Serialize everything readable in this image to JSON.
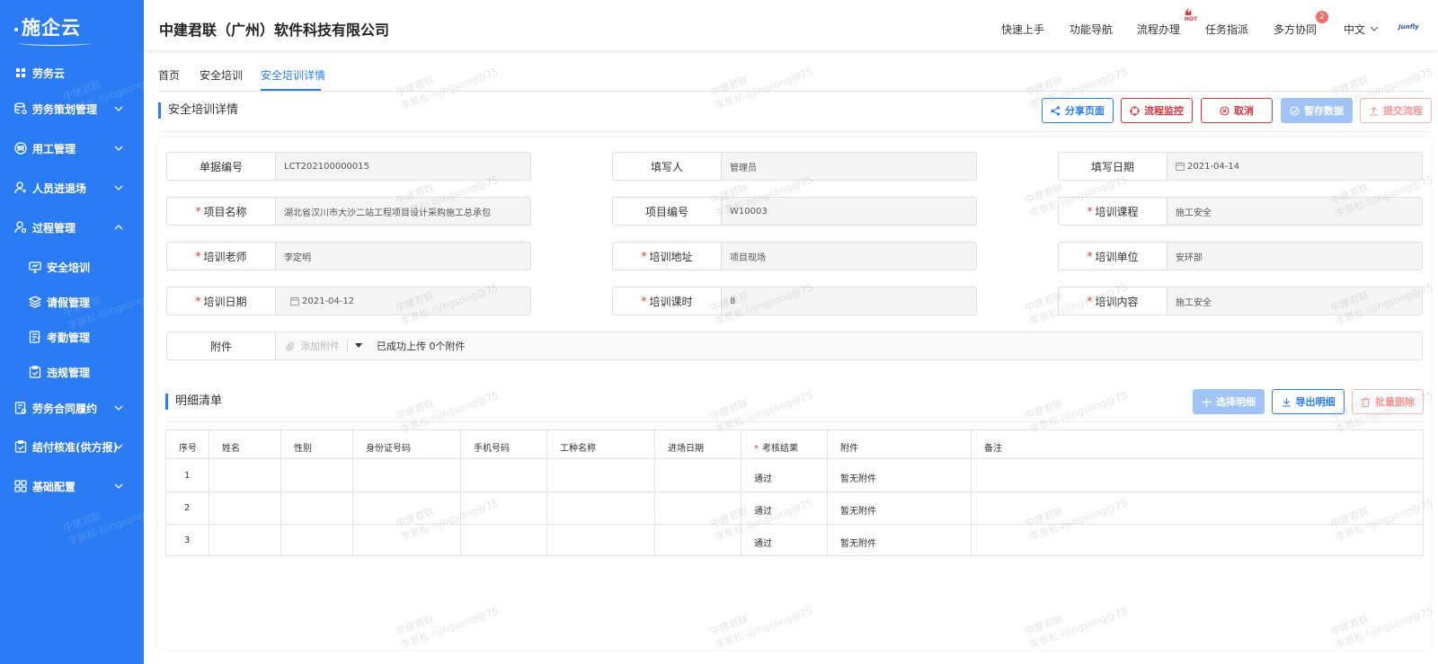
{
  "sidebar": {
    "logo": "施企云",
    "items": [
      {
        "label": "劳务云"
      },
      {
        "label": "劳务策划管理"
      },
      {
        "label": "用工管理"
      },
      {
        "label": "人员进退场"
      },
      {
        "label": "过程管理"
      },
      {
        "label": "安全培训"
      },
      {
        "label": "请假管理"
      },
      {
        "label": "考勤管理"
      },
      {
        "label": "违规管理"
      },
      {
        "label": "劳务合同履约"
      },
      {
        "label": "结付核准(供方报)"
      },
      {
        "label": "基础配置"
      }
    ]
  },
  "header": {
    "company": "中建君联（广州）软件科技有限公司",
    "nav": [
      "快速上手",
      "功能导航",
      "流程办理",
      "任务指派",
      "多方协同",
      "中文"
    ],
    "hot_tag": "HOT",
    "badge": "2",
    "brand_mini": "Junfly"
  },
  "tabs": [
    "首页",
    "安全培训",
    "安全培训详情"
  ],
  "section": {
    "title": "安全培训详情",
    "buttons": {
      "share": "分享页面",
      "monitor": "流程监控",
      "cancel": "取消",
      "save": "暂存数据",
      "submit": "提交流程"
    }
  },
  "form": {
    "doc_no": {
      "label": "单据编号",
      "value": "LCT202100000015"
    },
    "writer": {
      "label": "填写人",
      "value": "管理员"
    },
    "write_date": {
      "label": "填写日期",
      "value": "2021-04-14"
    },
    "project_name": {
      "label": "项目名称",
      "value": "湖北省汉川市大沙二站工程项目设计采购施工总承包"
    },
    "project_no": {
      "label": "项目编号",
      "value": "W10003"
    },
    "course": {
      "label": "培训课程",
      "value": "施工安全"
    },
    "teacher": {
      "label": "培训老师",
      "value": "李定明"
    },
    "address": {
      "label": "培训地址",
      "value": "项目现场"
    },
    "unit": {
      "label": "培训单位",
      "value": "安环部"
    },
    "train_date": {
      "label": "培训日期",
      "value": "2021-04-12"
    },
    "hours": {
      "label": "培训课时",
      "value": "8"
    },
    "content": {
      "label": "培训内容",
      "value": "施工安全"
    },
    "attachment": {
      "label": "附件",
      "add": "添加附件",
      "status": "已成功上传 0个附件"
    }
  },
  "detail": {
    "title": "明细清单",
    "buttons": {
      "select": "选择明细",
      "export": "导出明细",
      "delete": "批量删除"
    },
    "columns": [
      "序号",
      "姓名",
      "性别",
      "身份证号码",
      "手机号码",
      "工种名称",
      "进场日期",
      "考核结果",
      "附件",
      "备注"
    ],
    "rows": [
      {
        "no": "1",
        "result": "通过",
        "attach": "暂无附件"
      },
      {
        "no": "2",
        "result": "通过",
        "attach": "暂无附件"
      },
      {
        "no": "3",
        "result": "通过",
        "attach": "暂无附件"
      }
    ]
  },
  "watermark": {
    "line1": "中建君联",
    "line2": "李景松-lijingsong@75"
  }
}
